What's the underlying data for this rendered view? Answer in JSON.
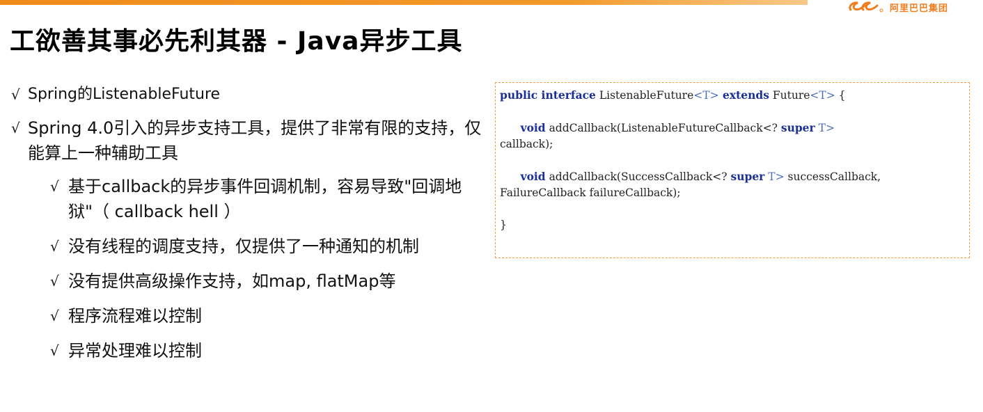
{
  "header": {
    "logo_text": "阿里巴巴集团",
    "brand_color": "#f08a1c"
  },
  "title": "工欲善其事必先利其器 - Java异步工具",
  "bullets": [
    {
      "level": 1,
      "text": "Spring的ListenableFuture"
    },
    {
      "level": 1,
      "text": "Spring 4.0引入的异步支持工具，提供了非常有限的支持，仅能算上一种辅助工具"
    },
    {
      "level": 2,
      "text": "基于callback的异步事件回调机制，容易导致\"回调地狱\"（ callback hell ）"
    },
    {
      "level": 2,
      "text": "没有线程的调度支持，仅提供了一种通知的机制"
    },
    {
      "level": 2,
      "text": "没有提供高级操作支持，如map, flatMap等"
    },
    {
      "level": 2,
      "text": "程序流程难以控制"
    },
    {
      "level": 2,
      "text": "异常处理难以控制"
    }
  ],
  "check_glyph": "√",
  "code": {
    "l1_kw1": "public interface",
    "l1_name": " ListenableFuture",
    "l1_gen1": "<T>",
    "l1_kw2": " extends",
    "l1_future": " Future",
    "l1_gen2": "<T>",
    "l1_brace": " {",
    "l2_indent": "      ",
    "l2_kw": "void",
    "l2_rest": " addCallback(ListenableFutureCallback<? ",
    "l2_super": "super",
    "l2_gen": " T>",
    "l3": "callback);",
    "l4_indent": "      ",
    "l4_kw": "void",
    "l4_rest": " addCallback(SuccessCallback<? ",
    "l4_super": "super",
    "l4_gen": " T>",
    "l4_tail": " successCallback,",
    "l5": "FailureCallback failureCallback);",
    "l6": "}"
  }
}
